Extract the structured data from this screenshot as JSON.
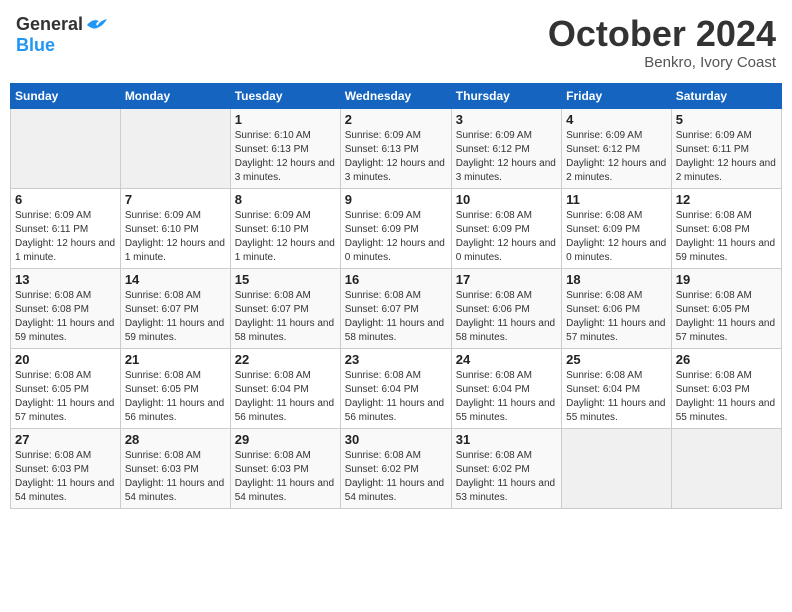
{
  "header": {
    "logo_general": "General",
    "logo_blue": "Blue",
    "month_title": "October 2024",
    "subtitle": "Benkro, Ivory Coast"
  },
  "weekdays": [
    "Sunday",
    "Monday",
    "Tuesday",
    "Wednesday",
    "Thursday",
    "Friday",
    "Saturday"
  ],
  "weeks": [
    [
      {
        "day": "",
        "sunrise": "",
        "sunset": "",
        "daylight": ""
      },
      {
        "day": "",
        "sunrise": "",
        "sunset": "",
        "daylight": ""
      },
      {
        "day": "1",
        "sunrise": "Sunrise: 6:10 AM",
        "sunset": "Sunset: 6:13 PM",
        "daylight": "Daylight: 12 hours and 3 minutes."
      },
      {
        "day": "2",
        "sunrise": "Sunrise: 6:09 AM",
        "sunset": "Sunset: 6:13 PM",
        "daylight": "Daylight: 12 hours and 3 minutes."
      },
      {
        "day": "3",
        "sunrise": "Sunrise: 6:09 AM",
        "sunset": "Sunset: 6:12 PM",
        "daylight": "Daylight: 12 hours and 3 minutes."
      },
      {
        "day": "4",
        "sunrise": "Sunrise: 6:09 AM",
        "sunset": "Sunset: 6:12 PM",
        "daylight": "Daylight: 12 hours and 2 minutes."
      },
      {
        "day": "5",
        "sunrise": "Sunrise: 6:09 AM",
        "sunset": "Sunset: 6:11 PM",
        "daylight": "Daylight: 12 hours and 2 minutes."
      }
    ],
    [
      {
        "day": "6",
        "sunrise": "Sunrise: 6:09 AM",
        "sunset": "Sunset: 6:11 PM",
        "daylight": "Daylight: 12 hours and 1 minute."
      },
      {
        "day": "7",
        "sunrise": "Sunrise: 6:09 AM",
        "sunset": "Sunset: 6:10 PM",
        "daylight": "Daylight: 12 hours and 1 minute."
      },
      {
        "day": "8",
        "sunrise": "Sunrise: 6:09 AM",
        "sunset": "Sunset: 6:10 PM",
        "daylight": "Daylight: 12 hours and 1 minute."
      },
      {
        "day": "9",
        "sunrise": "Sunrise: 6:09 AM",
        "sunset": "Sunset: 6:09 PM",
        "daylight": "Daylight: 12 hours and 0 minutes."
      },
      {
        "day": "10",
        "sunrise": "Sunrise: 6:08 AM",
        "sunset": "Sunset: 6:09 PM",
        "daylight": "Daylight: 12 hours and 0 minutes."
      },
      {
        "day": "11",
        "sunrise": "Sunrise: 6:08 AM",
        "sunset": "Sunset: 6:09 PM",
        "daylight": "Daylight: 12 hours and 0 minutes."
      },
      {
        "day": "12",
        "sunrise": "Sunrise: 6:08 AM",
        "sunset": "Sunset: 6:08 PM",
        "daylight": "Daylight: 11 hours and 59 minutes."
      }
    ],
    [
      {
        "day": "13",
        "sunrise": "Sunrise: 6:08 AM",
        "sunset": "Sunset: 6:08 PM",
        "daylight": "Daylight: 11 hours and 59 minutes."
      },
      {
        "day": "14",
        "sunrise": "Sunrise: 6:08 AM",
        "sunset": "Sunset: 6:07 PM",
        "daylight": "Daylight: 11 hours and 59 minutes."
      },
      {
        "day": "15",
        "sunrise": "Sunrise: 6:08 AM",
        "sunset": "Sunset: 6:07 PM",
        "daylight": "Daylight: 11 hours and 58 minutes."
      },
      {
        "day": "16",
        "sunrise": "Sunrise: 6:08 AM",
        "sunset": "Sunset: 6:07 PM",
        "daylight": "Daylight: 11 hours and 58 minutes."
      },
      {
        "day": "17",
        "sunrise": "Sunrise: 6:08 AM",
        "sunset": "Sunset: 6:06 PM",
        "daylight": "Daylight: 11 hours and 58 minutes."
      },
      {
        "day": "18",
        "sunrise": "Sunrise: 6:08 AM",
        "sunset": "Sunset: 6:06 PM",
        "daylight": "Daylight: 11 hours and 57 minutes."
      },
      {
        "day": "19",
        "sunrise": "Sunrise: 6:08 AM",
        "sunset": "Sunset: 6:05 PM",
        "daylight": "Daylight: 11 hours and 57 minutes."
      }
    ],
    [
      {
        "day": "20",
        "sunrise": "Sunrise: 6:08 AM",
        "sunset": "Sunset: 6:05 PM",
        "daylight": "Daylight: 11 hours and 57 minutes."
      },
      {
        "day": "21",
        "sunrise": "Sunrise: 6:08 AM",
        "sunset": "Sunset: 6:05 PM",
        "daylight": "Daylight: 11 hours and 56 minutes."
      },
      {
        "day": "22",
        "sunrise": "Sunrise: 6:08 AM",
        "sunset": "Sunset: 6:04 PM",
        "daylight": "Daylight: 11 hours and 56 minutes."
      },
      {
        "day": "23",
        "sunrise": "Sunrise: 6:08 AM",
        "sunset": "Sunset: 6:04 PM",
        "daylight": "Daylight: 11 hours and 56 minutes."
      },
      {
        "day": "24",
        "sunrise": "Sunrise: 6:08 AM",
        "sunset": "Sunset: 6:04 PM",
        "daylight": "Daylight: 11 hours and 55 minutes."
      },
      {
        "day": "25",
        "sunrise": "Sunrise: 6:08 AM",
        "sunset": "Sunset: 6:04 PM",
        "daylight": "Daylight: 11 hours and 55 minutes."
      },
      {
        "day": "26",
        "sunrise": "Sunrise: 6:08 AM",
        "sunset": "Sunset: 6:03 PM",
        "daylight": "Daylight: 11 hours and 55 minutes."
      }
    ],
    [
      {
        "day": "27",
        "sunrise": "Sunrise: 6:08 AM",
        "sunset": "Sunset: 6:03 PM",
        "daylight": "Daylight: 11 hours and 54 minutes."
      },
      {
        "day": "28",
        "sunrise": "Sunrise: 6:08 AM",
        "sunset": "Sunset: 6:03 PM",
        "daylight": "Daylight: 11 hours and 54 minutes."
      },
      {
        "day": "29",
        "sunrise": "Sunrise: 6:08 AM",
        "sunset": "Sunset: 6:03 PM",
        "daylight": "Daylight: 11 hours and 54 minutes."
      },
      {
        "day": "30",
        "sunrise": "Sunrise: 6:08 AM",
        "sunset": "Sunset: 6:02 PM",
        "daylight": "Daylight: 11 hours and 54 minutes."
      },
      {
        "day": "31",
        "sunrise": "Sunrise: 6:08 AM",
        "sunset": "Sunset: 6:02 PM",
        "daylight": "Daylight: 11 hours and 53 minutes."
      },
      {
        "day": "",
        "sunrise": "",
        "sunset": "",
        "daylight": ""
      },
      {
        "day": "",
        "sunrise": "",
        "sunset": "",
        "daylight": ""
      }
    ]
  ]
}
